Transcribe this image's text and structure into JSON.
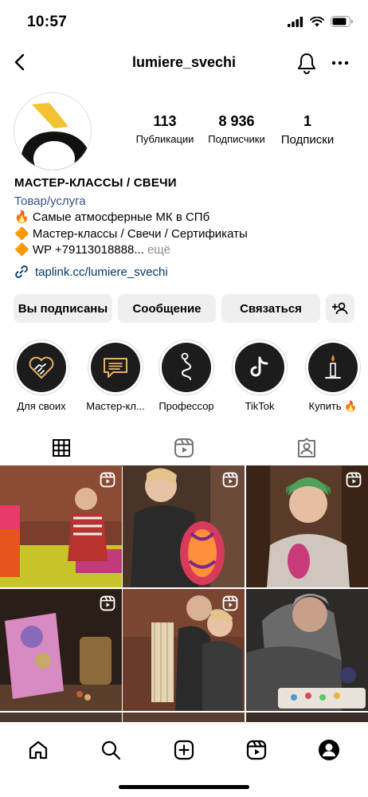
{
  "status": {
    "time": "10:57"
  },
  "nav": {
    "username": "lumiere_svechi"
  },
  "profile": {
    "stats": {
      "posts_count": "113",
      "posts_label": "Публикации",
      "followers_count": "8 936",
      "followers_label": "Подписчики",
      "following_count": "1",
      "following_label": "Подписки"
    },
    "bio": {
      "name": "МАСТЕР-КЛАССЫ / СВЕЧИ",
      "category": "Товар/услуга",
      "line1": "🔥 Самые атмосферные МК в СПб",
      "line2": "🔶 Мастер-классы / Свечи / Сертификаты",
      "line3": "🔶 WP +79113018888...",
      "more": "ещё",
      "link": "taplink.cc/lumiere_svechi"
    }
  },
  "actions": {
    "following": "Вы подписаны",
    "message": "Сообщение",
    "contact": "Связаться"
  },
  "highlights": [
    {
      "label": "Для своих",
      "icon": "handshake-icon"
    },
    {
      "label": "Мастер-кл...",
      "icon": "chat-bubble-icon"
    },
    {
      "label": "Профессор",
      "icon": "snake-icon"
    },
    {
      "label": "TikTok",
      "icon": "tiktok-icon"
    },
    {
      "label": "Купить 🔥",
      "icon": "candle-icon"
    }
  ],
  "colors": {
    "link": "#00376b",
    "category": "#385185",
    "button_bg": "#efefef",
    "muted": "#8e8e8e",
    "logo_yellow": "#f2c230"
  }
}
